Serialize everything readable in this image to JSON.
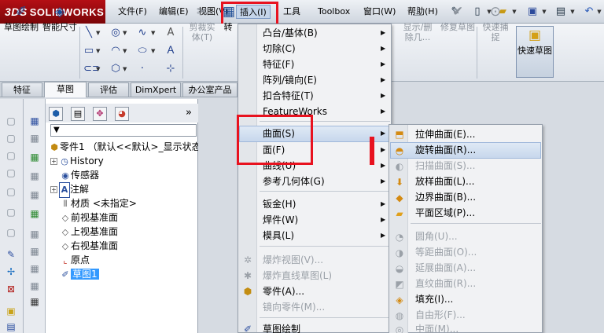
{
  "app": {
    "logo_prefix": "3DS",
    "logo_text": "SOLIDWORKS"
  },
  "menubar": {
    "items": [
      "文件(F)",
      "编辑(E)",
      "视图(V)",
      "插入(I)",
      "工具",
      "Toolbox",
      "窗口(W)",
      "帮助(H)"
    ]
  },
  "ribbon": {
    "sketch_label": "草图绘制",
    "dimension_label": "智能尺寸",
    "trim_label": "剪裁实体(T)",
    "convert_label": "转",
    "showhide_label": "显示/删除几...",
    "repair_label": "修复草图",
    "snap_label": "快速捕捉",
    "quick_sketch_label": "快速草图"
  },
  "tabs": [
    "特征",
    "草图",
    "评估",
    "DimXpert",
    "办公室产品"
  ],
  "tree": {
    "part": "零件1 （默认<<默认>_显示状态",
    "items": [
      "History",
      "传感器",
      "注解",
      "材质 <未指定>",
      "前视基准面",
      "上视基准面",
      "右视基准面",
      "原点",
      "草图1"
    ]
  },
  "insert_menu": {
    "items": [
      {
        "label": "凸台/基体(B)",
        "sub": true
      },
      {
        "label": "切除(C)",
        "sub": true
      },
      {
        "label": "特征(F)",
        "sub": true
      },
      {
        "label": "阵列/镜向(E)",
        "sub": true
      },
      {
        "label": "扣合特征(T)",
        "sub": true
      },
      {
        "label": "FeatureWorks",
        "sub": true
      },
      {
        "label": "曲面(S)",
        "sub": true
      },
      {
        "label": "面(F)",
        "sub": true
      },
      {
        "label": "曲线(U)",
        "sub": true
      },
      {
        "label": "参考几何体(G)",
        "sub": true
      },
      {
        "label": "钣金(H)",
        "sub": true
      },
      {
        "label": "焊件(W)",
        "sub": true
      },
      {
        "label": "模具(L)",
        "sub": true
      },
      {
        "label": "爆炸视图(V)...",
        "sub": false
      },
      {
        "label": "爆炸直线草图(L)",
        "sub": false
      },
      {
        "label": "零件(A)...",
        "sub": false
      },
      {
        "label": "镜向零件(M)...",
        "sub": false
      },
      {
        "label": "草图绘制",
        "sub": false
      }
    ]
  },
  "surface_menu": {
    "items": [
      "拉伸曲面(E)...",
      "旋转曲面(R)...",
      "扫描曲面(S)...",
      "放样曲面(L)...",
      "边界曲面(B)...",
      "平面区域(P)...",
      "圆角(U)...",
      "等距曲面(O)...",
      "延展曲面(A)...",
      "直纹曲面(R)...",
      "填充(I)...",
      "自由形(F)...",
      "中面(M)..."
    ]
  },
  "colors": {
    "highlight_box": "#e8121f",
    "selection": "#3399ff",
    "logo_bg": "#b40f15"
  }
}
